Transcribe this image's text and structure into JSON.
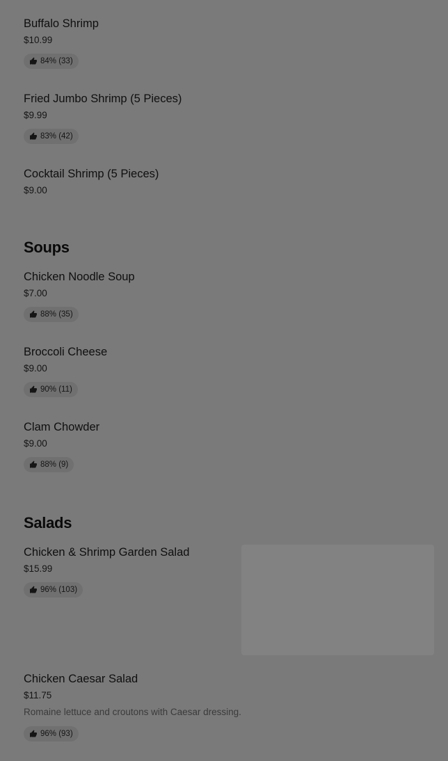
{
  "colors": {
    "overlay_background": "#7a7a7a",
    "badge_background": "#707070",
    "text": "#111111"
  },
  "items_top": [
    {
      "name": "Buffalo Shrimp",
      "price": "$10.99",
      "rating": "84% (33)"
    },
    {
      "name": "Fried Jumbo Shrimp (5 Pieces)",
      "price": "$9.99",
      "rating": "83% (42)"
    },
    {
      "name": "Cocktail Shrimp (5 Pieces)",
      "price": "$9.00"
    }
  ],
  "soups": {
    "title": "Soups",
    "items": [
      {
        "name": "Chicken Noodle Soup",
        "price": "$7.00",
        "rating": "88% (35)"
      },
      {
        "name": "Broccoli Cheese",
        "price": "$9.00",
        "rating": "90% (11)"
      },
      {
        "name": "Clam Chowder",
        "price": "$9.00",
        "rating": "88% (9)"
      }
    ]
  },
  "salads": {
    "title": "Salads",
    "items": [
      {
        "name": "Chicken & Shrimp Garden Salad",
        "price": "$15.99",
        "rating": "96% (103)"
      },
      {
        "name": "Chicken Caesar Salad",
        "price": "$11.75",
        "description": "Romaine lettuce and croutons with Caesar dressing.",
        "rating": "96% (93)"
      }
    ]
  },
  "icons": {
    "rating": "thumbs-up-icon"
  }
}
